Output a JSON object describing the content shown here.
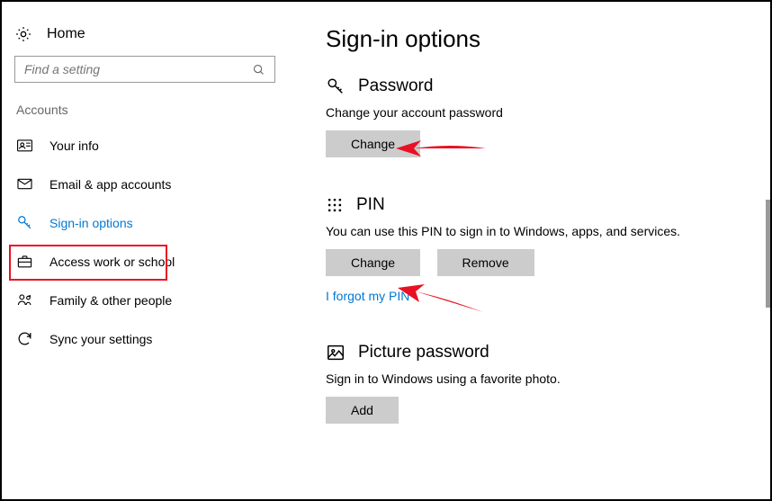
{
  "header": {
    "home_label": "Home"
  },
  "search": {
    "placeholder": "Find a setting"
  },
  "category_label": "Accounts",
  "nav": {
    "your_info": "Your info",
    "email_accounts": "Email & app accounts",
    "sign_in_options": "Sign-in options",
    "access_work": "Access work or school",
    "family": "Family & other people",
    "sync": "Sync your settings"
  },
  "page_title": "Sign-in options",
  "sections": {
    "password": {
      "title": "Password",
      "desc": "Change your account password",
      "change_btn": "Change"
    },
    "pin": {
      "title": "PIN",
      "desc": "You can use this PIN to sign in to Windows, apps, and services.",
      "change_btn": "Change",
      "remove_btn": "Remove",
      "forgot_link": "I forgot my PIN"
    },
    "picture": {
      "title": "Picture password",
      "desc": "Sign in to Windows using a favorite photo.",
      "add_btn": "Add"
    }
  }
}
